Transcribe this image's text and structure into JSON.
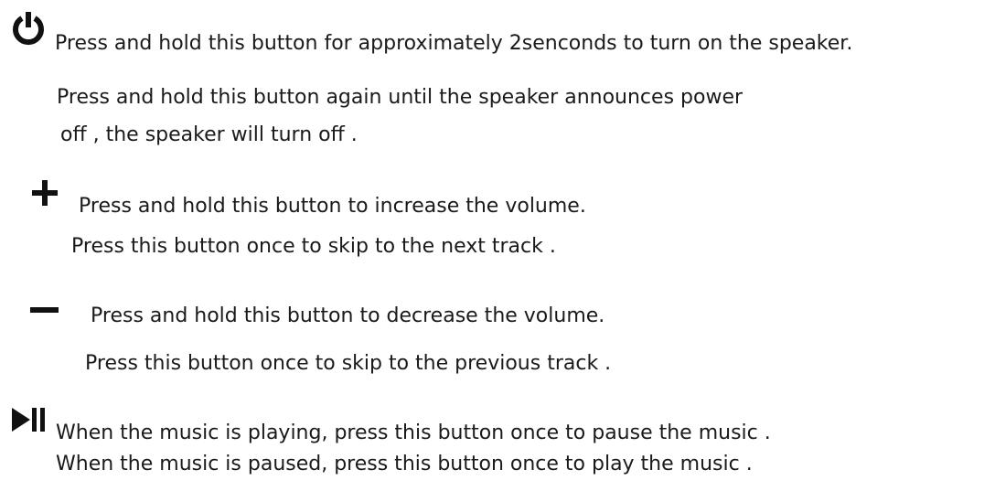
{
  "sections": [
    {
      "icon": "power-icon",
      "lines": [
        "Press and hold this button for approximately 2senconds to turn on the speaker.",
        "Press and hold this button again until the speaker announces power",
        " off , the speaker will turn off ."
      ]
    },
    {
      "icon": "plus-icon",
      "lines": [
        "Press and hold this button to increase the volume.",
        " Press this button once to skip to the next track ."
      ]
    },
    {
      "icon": "minus-icon",
      "lines": [
        "Press and hold this button to decrease the volume.",
        "Press this button once to skip to the previous track ."
      ]
    },
    {
      "icon": "play-pause-icon",
      "lines": [
        "When the music is playing, press this button once to pause the music .",
        "When the music is paused, press this button once to play the music ."
      ]
    }
  ],
  "colors": {
    "text": "#1a1a1a",
    "icon": "#111111",
    "background": "#ffffff"
  }
}
